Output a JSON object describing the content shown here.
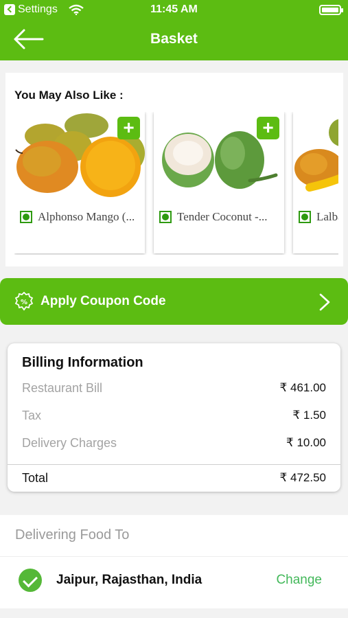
{
  "status_bar": {
    "back_app": "Settings",
    "time": "11:45 AM"
  },
  "nav": {
    "title": "Basket"
  },
  "suggestions": {
    "heading": "You May Also Like :",
    "items": [
      {
        "name": "Alphonso Mango (...",
        "add": "+"
      },
      {
        "name": "Tender Coconut -...",
        "add": "+"
      },
      {
        "name": "Lalbagh Mango",
        "add": "+"
      }
    ]
  },
  "coupon": {
    "label": "Apply Coupon Code"
  },
  "billing": {
    "title": "Billing Information",
    "rows": [
      {
        "label": "Restaurant Bill",
        "value": "₹ 461.00"
      },
      {
        "label": "Tax",
        "value": "₹ 1.50"
      },
      {
        "label": "Delivery Charges",
        "value": "₹ 10.00"
      }
    ],
    "total": {
      "label": "Total",
      "value": "₹ 472.50"
    }
  },
  "delivery": {
    "heading": "Delivering Food To",
    "address": "Jaipur, Rajasthan, India",
    "change_label": "Change"
  },
  "colors": {
    "brand_green": "#5cbc12",
    "change_green": "#43b85a"
  }
}
